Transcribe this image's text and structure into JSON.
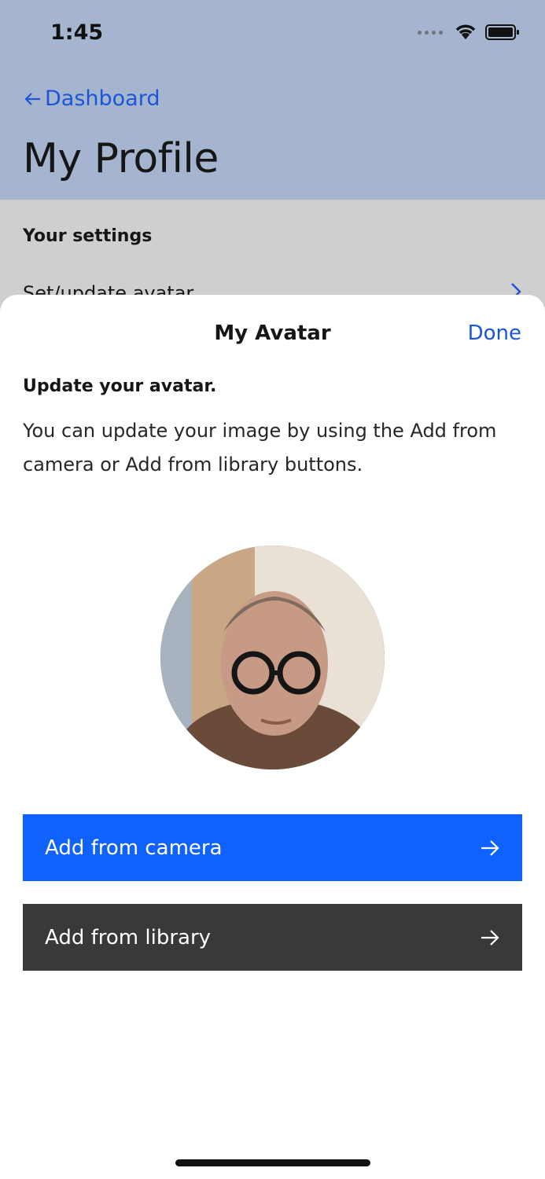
{
  "status_bar": {
    "time": "1:45"
  },
  "nav": {
    "back_label": "Dashboard",
    "page_title": "My Profile"
  },
  "settings": {
    "heading": "Your settings",
    "row_label": "Set/update avatar"
  },
  "sheet": {
    "title": "My Avatar",
    "done_label": "Done",
    "heading": "Update your avatar.",
    "description": "You can update your image by using the Add from camera or Add from library buttons."
  },
  "buttons": {
    "camera_label": "Add from camera",
    "library_label": "Add from library"
  },
  "colors": {
    "accent_blue": "#0f62fe",
    "link_blue": "#1b56d6",
    "dark_button": "#393939",
    "header_bg": "#a6b5cf"
  }
}
